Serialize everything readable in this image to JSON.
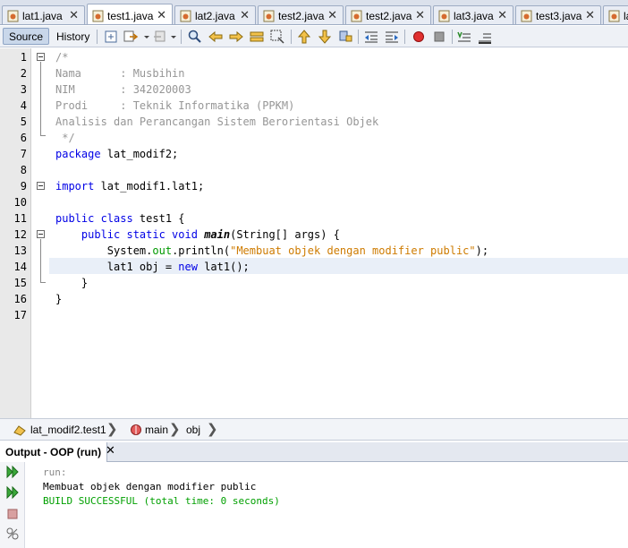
{
  "tabs": [
    {
      "label": "lat1.java",
      "active": false
    },
    {
      "label": "test1.java",
      "active": true
    },
    {
      "label": "lat2.java",
      "active": false
    },
    {
      "label": "test2.java",
      "active": false
    },
    {
      "label": "test2.java",
      "active": false
    },
    {
      "label": "lat3.java",
      "active": false
    },
    {
      "label": "test3.java",
      "active": false
    },
    {
      "label": "lat",
      "active": false
    }
  ],
  "toolbar": {
    "source_label": "Source",
    "history_label": "History",
    "icons": [
      "last-edit-icon",
      "back-icon",
      "forward-icon",
      "find-icon",
      "find-previous-icon",
      "find-next-icon",
      "toggle-highlight-icon",
      "select-icon",
      "previous-bookmark-icon",
      "next-bookmark-icon",
      "toggle-bookmark-icon",
      "shift-left-icon",
      "shift-right-icon",
      "start-macro-icon",
      "stop-macro-icon",
      "comment-icon",
      "uncomment-icon"
    ]
  },
  "editor": {
    "line_numbers": [
      "1",
      "2",
      "3",
      "4",
      "5",
      "6",
      "7",
      "8",
      "9",
      "10",
      "11",
      "12",
      "13",
      "14",
      "15",
      "16",
      "17"
    ],
    "current_line": 14,
    "lines": {
      "l1": "/*",
      "l2": "Nama      : Musbihin",
      "l3": "NIM       : 342020003",
      "l4": "Prodi     : Teknik Informatika (PPKM)",
      "l5": "Analisis dan Perancangan Sistem Berorientasi Objek",
      "l6": " */",
      "l7_kw": "package",
      "l7_rest": " lat_modif2;",
      "l9_kw": "import",
      "l9_rest": " lat_modif1.lat1;",
      "l11_kw": "public class",
      "l11_rest": " test1 {",
      "l12_indent": "    ",
      "l12_kw": "public static void",
      "l12_sp": " ",
      "l12_method": "main",
      "l12_rest": "(String[] args) {",
      "l13_a": "        System.",
      "l13_field": "out",
      "l13_b": ".println(",
      "l13_str": "\"Membuat objek dengan modifier public\"",
      "l13_c": ");",
      "l14_a": "        lat1 obj = ",
      "l14_kw": "new",
      "l14_b": " lat1();",
      "l15": "    }",
      "l16": "}"
    }
  },
  "breadcrumb": {
    "class_label": "lat_modif2.test1",
    "method_label": "main",
    "var_label": "obj"
  },
  "output": {
    "tab_label": "Output - OOP (run)",
    "close": "✕",
    "lines": {
      "run": "run:",
      "message": "Membuat objek dengan modifier public",
      "build": "BUILD SUCCESSFUL (total time: 0 seconds)"
    },
    "colors": {
      "run": "#888888",
      "message": "#000000",
      "build": "#00a000"
    }
  },
  "colors": {
    "keyword": "#0000e6",
    "comment": "#969696",
    "string": "#ce7b00",
    "field": "#009900"
  }
}
